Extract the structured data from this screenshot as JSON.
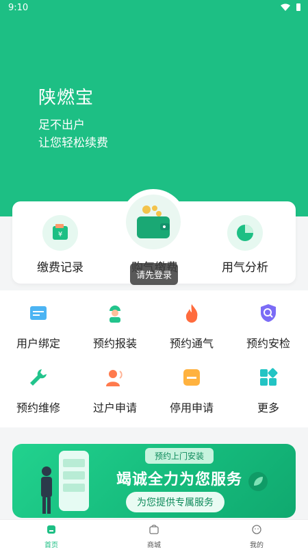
{
  "status_bar": {
    "time": "9:10"
  },
  "hero": {
    "title": "陕燃宝",
    "line1": "足不出户",
    "line2": "让您轻松续费"
  },
  "quick_actions": {
    "left": "缴费记录",
    "center": "购气缴费",
    "right": "用气分析"
  },
  "toast": "请先登录",
  "services": [
    {
      "label": "用户绑定",
      "icon": "card-icon"
    },
    {
      "label": "预约报装",
      "icon": "worker-icon"
    },
    {
      "label": "预约通气",
      "icon": "flame-icon"
    },
    {
      "label": "预约安检",
      "icon": "shield-search-icon"
    },
    {
      "label": "预约维修",
      "icon": "wrench-icon"
    },
    {
      "label": "过户申请",
      "icon": "transfer-user-icon"
    },
    {
      "label": "停用申请",
      "icon": "stop-icon"
    },
    {
      "label": "更多",
      "icon": "grid-icon"
    }
  ],
  "banner": {
    "tag": "预约上门安装",
    "headline": "竭诚全力为您服务",
    "sub": "为您提供专属服务"
  },
  "tabbar": [
    {
      "label": "首页",
      "icon": "home-icon"
    },
    {
      "label": "商城",
      "icon": "shop-icon"
    },
    {
      "label": "我的",
      "icon": "user-icon"
    }
  ],
  "colors": {
    "brand": "#1dbf84"
  }
}
